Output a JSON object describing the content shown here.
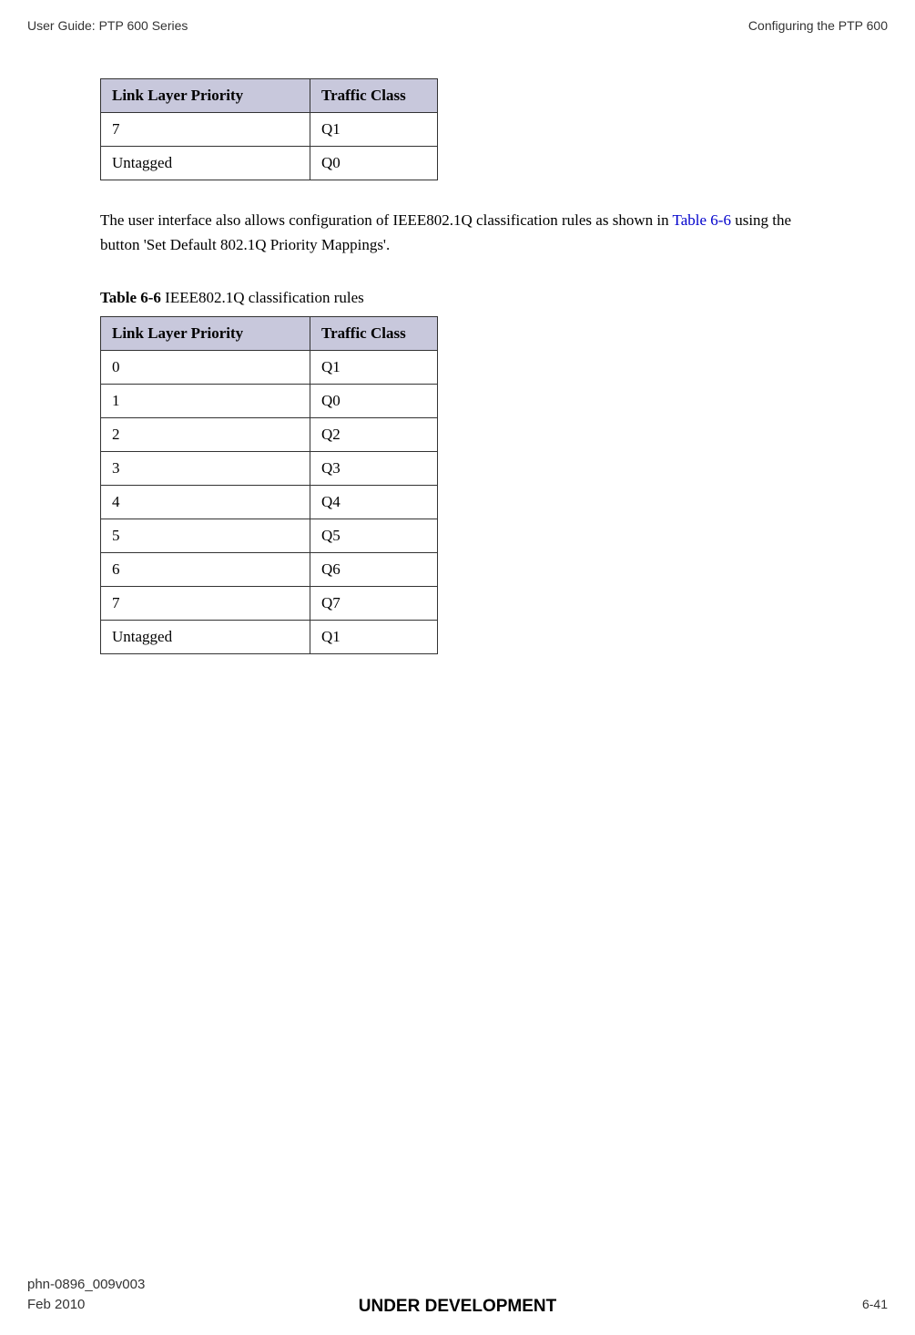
{
  "header": {
    "left": "User Guide: PTP 600 Series",
    "right": "Configuring the PTP 600"
  },
  "table1": {
    "headers": [
      "Link Layer Priority",
      "Traffic Class"
    ],
    "rows": [
      [
        "7",
        "Q1"
      ],
      [
        "Untagged",
        "Q0"
      ]
    ]
  },
  "paragraph": {
    "text1": "The user interface also allows configuration of IEEE802.1Q classification rules as shown in ",
    "link": "Table 6-6",
    "text2": " using the button 'Set Default 802.1Q Priority Mappings'."
  },
  "table2_caption": {
    "label": "Table 6-6",
    "title": "  IEEE802.1Q classification rules"
  },
  "table2": {
    "headers": [
      "Link Layer Priority",
      "Traffic Class"
    ],
    "rows": [
      [
        "0",
        "Q1"
      ],
      [
        "1",
        "Q0"
      ],
      [
        "2",
        "Q2"
      ],
      [
        "3",
        "Q3"
      ],
      [
        "4",
        "Q4"
      ],
      [
        "5",
        "Q5"
      ],
      [
        "6",
        "Q6"
      ],
      [
        "7",
        "Q7"
      ],
      [
        "Untagged",
        "Q1"
      ]
    ]
  },
  "chart_data": [
    {
      "type": "table",
      "title": "Link Layer Priority to Traffic Class (partial)",
      "columns": [
        "Link Layer Priority",
        "Traffic Class"
      ],
      "rows": [
        {
          "Link Layer Priority": "7",
          "Traffic Class": "Q1"
        },
        {
          "Link Layer Priority": "Untagged",
          "Traffic Class": "Q0"
        }
      ]
    },
    {
      "type": "table",
      "title": "Table 6-6 IEEE802.1Q classification rules",
      "columns": [
        "Link Layer Priority",
        "Traffic Class"
      ],
      "rows": [
        {
          "Link Layer Priority": "0",
          "Traffic Class": "Q1"
        },
        {
          "Link Layer Priority": "1",
          "Traffic Class": "Q0"
        },
        {
          "Link Layer Priority": "2",
          "Traffic Class": "Q2"
        },
        {
          "Link Layer Priority": "3",
          "Traffic Class": "Q3"
        },
        {
          "Link Layer Priority": "4",
          "Traffic Class": "Q4"
        },
        {
          "Link Layer Priority": "5",
          "Traffic Class": "Q5"
        },
        {
          "Link Layer Priority": "6",
          "Traffic Class": "Q6"
        },
        {
          "Link Layer Priority": "7",
          "Traffic Class": "Q7"
        },
        {
          "Link Layer Priority": "Untagged",
          "Traffic Class": "Q1"
        }
      ]
    }
  ],
  "footer": {
    "doc_id": "phn-0896_009v003",
    "date": "Feb 2010",
    "status": "UNDER DEVELOPMENT",
    "page": "6-41"
  }
}
